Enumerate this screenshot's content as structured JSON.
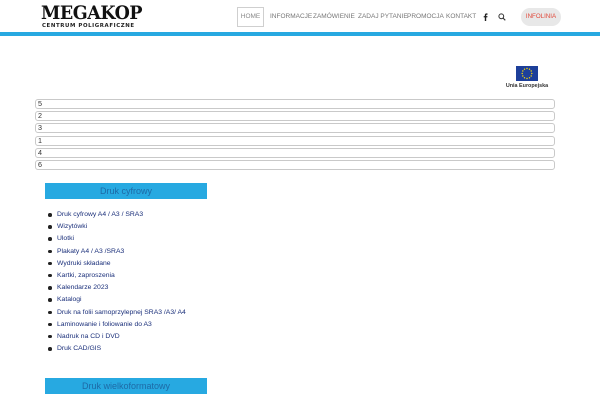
{
  "header": {
    "logo_main": "MEGAKOP",
    "logo_sub": "CENTRUM POLIGRAFICZNE",
    "nav": [
      {
        "label": "HOME",
        "active": true
      },
      {
        "label": "INFORMACJE",
        "active": false
      },
      {
        "label": "ZAMÓWIENIE",
        "active": false
      },
      {
        "label": "ZADAJ PYTANIE",
        "active": false
      },
      {
        "label": "PROMOCJA",
        "active": false
      },
      {
        "label": "KONTAKT",
        "active": false
      }
    ],
    "icons": [
      "facebook-icon",
      "search-icon"
    ],
    "infolinia_label": "INFOLINIA",
    "accent_color": "#27a9e1",
    "infolinia_color": "#e0483a"
  },
  "eu_badge": {
    "label": "Unia Europejska",
    "flag_color": "#1d3f9a",
    "star_color": "#ffdd00"
  },
  "number_rows": [
    "5",
    "2",
    "3",
    "1",
    "4",
    "6"
  ],
  "categories": [
    {
      "title": "Druk cyfrowy",
      "items": [
        "Druk cyfrowy A4 / A3 / SRA3",
        "Wizytówki",
        "Ulotki",
        "Plakaty A4 / A3 /SRA3",
        "Wydruki składane",
        "Kartki, zaproszenia",
        "Kalendarze 2023",
        "Katalogi",
        "Druk na folii samoprzylepnej SRA3 /A3/ A4",
        "Laminowanie i foliowanie do A3",
        "Nadruk na CD i DVD",
        "Druk CAD/GIS"
      ]
    },
    {
      "title": "Druk wielkoformatowy",
      "items": []
    }
  ]
}
